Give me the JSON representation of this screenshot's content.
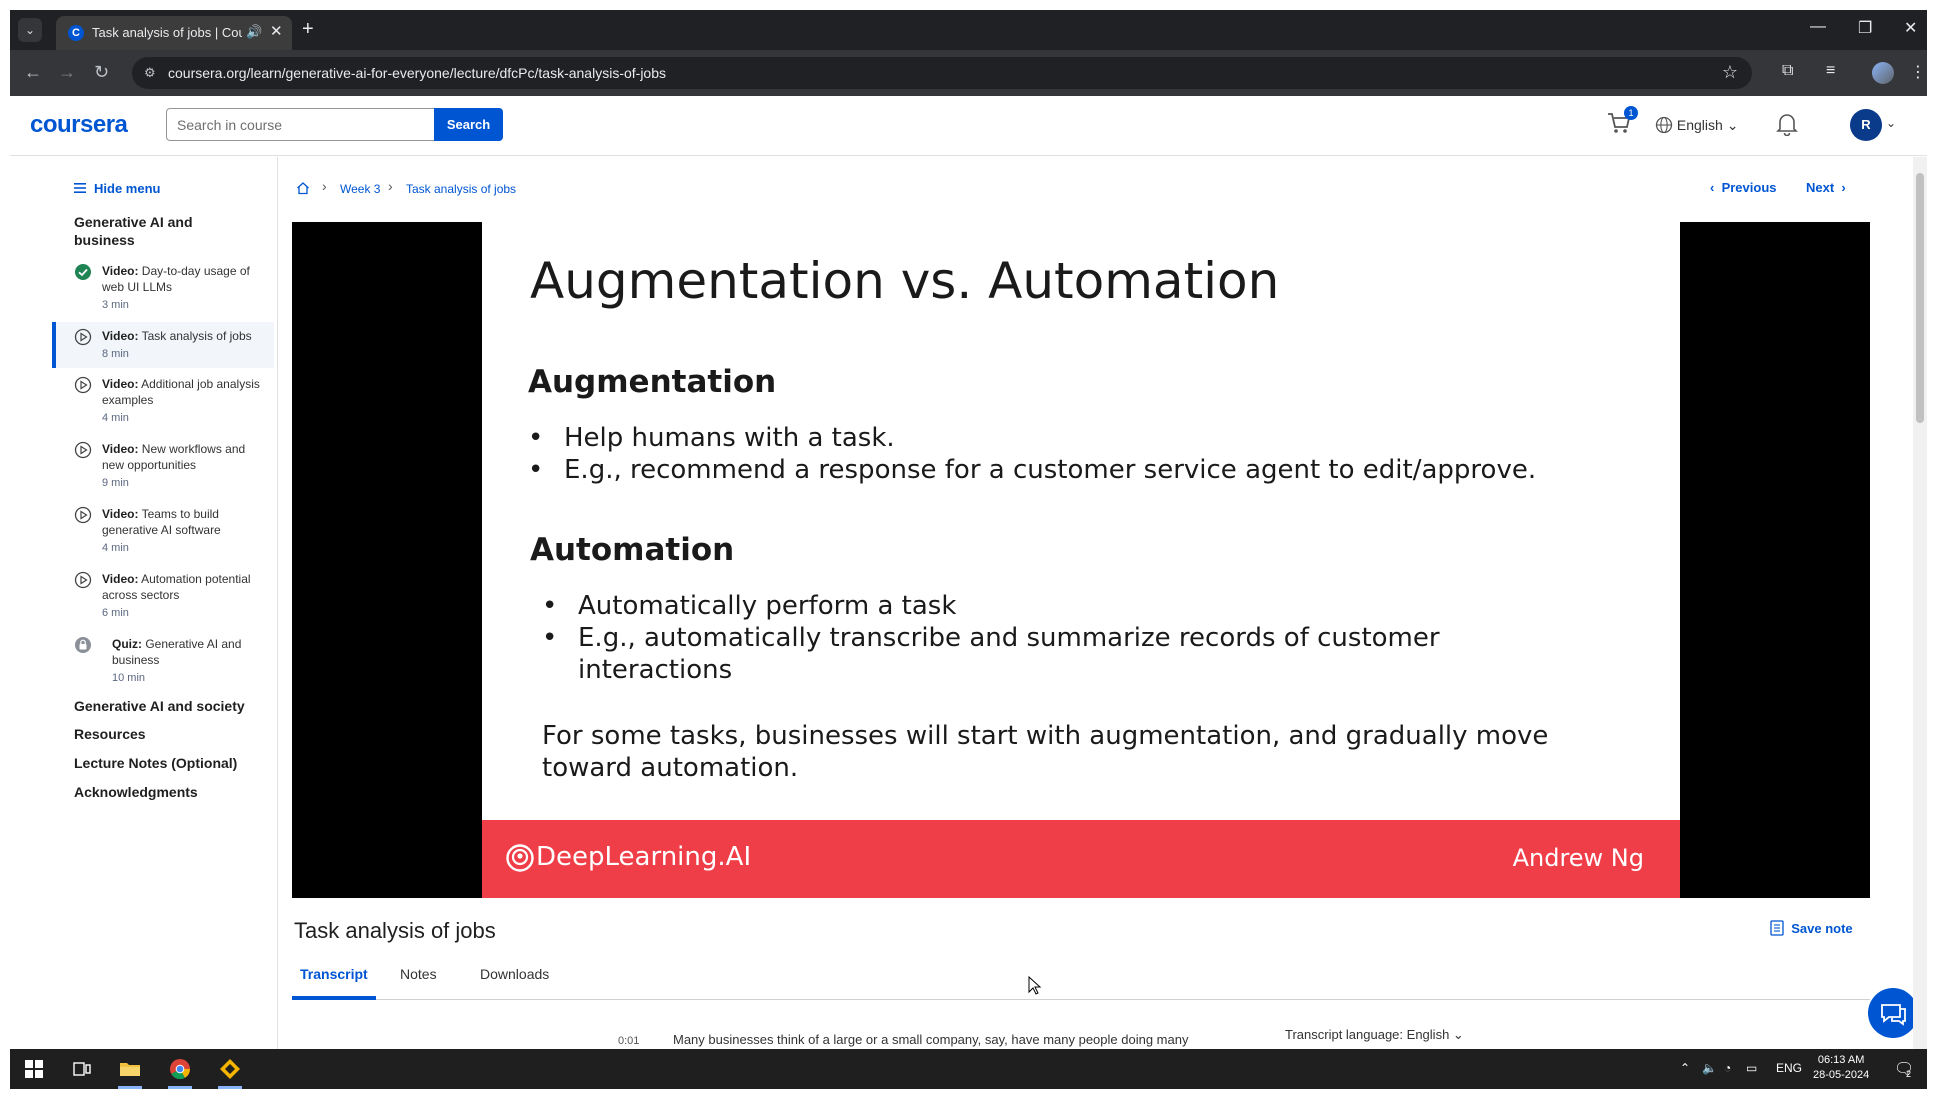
{
  "browser": {
    "tab_title": "Task analysis of jobs | Coursera",
    "tab_favicon": "C",
    "url": "coursera.org/learn/generative-ai-for-everyone/lecture/dfcPc/task-analysis-of-jobs"
  },
  "header": {
    "logo": "coursera",
    "search_placeholder": "Search in course",
    "search_button": "Search",
    "cart_count": "1",
    "language": "English",
    "avatar_initial": "R"
  },
  "sidebar": {
    "hide_menu": "Hide menu",
    "module_title": "Generative AI and business",
    "items": [
      {
        "type": "Video:",
        "title": "Day-to-day usage of web UI LLMs",
        "duration": "3 min",
        "status": "completed"
      },
      {
        "type": "Video:",
        "title": "Task analysis of jobs",
        "duration": "8 min",
        "status": "current"
      },
      {
        "type": "Video:",
        "title": "Additional job analysis examples",
        "duration": "4 min",
        "status": "todo"
      },
      {
        "type": "Video:",
        "title": "New workflows and new opportunities",
        "duration": "9 min",
        "status": "todo"
      },
      {
        "type": "Video:",
        "title": "Teams to build generative AI software",
        "duration": "4 min",
        "status": "todo"
      },
      {
        "type": "Video:",
        "title": "Automation potential across sectors",
        "duration": "6 min",
        "status": "todo"
      },
      {
        "type": "Quiz:",
        "title": "Generative AI and business",
        "duration": "10 min",
        "status": "locked"
      }
    ],
    "sections": [
      "Generative AI and society",
      "Resources",
      "Lecture Notes (Optional)",
      "Acknowledgments"
    ]
  },
  "breadcrumb": {
    "week": "Week 3",
    "current": "Task analysis of jobs"
  },
  "nav": {
    "previous": "Previous",
    "next": "Next"
  },
  "slide": {
    "title": "Augmentation vs. Automation",
    "augmentation_heading": "Augmentation",
    "augmentation_points": [
      "Help humans with a task.",
      "E.g., recommend a response for a customer service agent to edit/approve."
    ],
    "automation_heading": "Automation",
    "automation_points": [
      "Automatically perform a task",
      "E.g., automatically transcribe and summarize records of customer interactions"
    ],
    "note": "For some tasks, businesses will start with augmentation, and gradually move toward automation.",
    "brand": "DeepLearning.AI",
    "author": "Andrew Ng"
  },
  "lecture": {
    "title": "Task analysis of jobs",
    "save_note": "Save note",
    "tabs": [
      "Transcript",
      "Notes",
      "Downloads"
    ],
    "transcript_time": "0:01",
    "transcript_text": "Many businesses think of a large or a small company, say, have many people doing many",
    "transcript_language_label": "Transcript language:",
    "transcript_language": "English"
  },
  "taskbar": {
    "lang": "ENG",
    "time": "06:13 AM",
    "date": "28-05-2024",
    "notifications": "2"
  },
  "colors": {
    "brand": "#0056d2",
    "slide_footer": "#ef3e48",
    "complete": "#1f8354"
  }
}
